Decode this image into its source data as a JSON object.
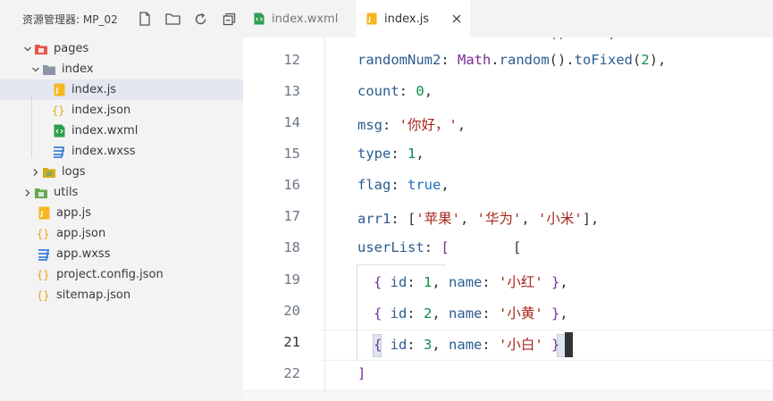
{
  "explorer": {
    "title": "资源管理器: MP_02",
    "actions": [
      "new-file-icon",
      "new-folder-icon",
      "refresh-icon",
      "collapse-all-icon"
    ],
    "tree": [
      {
        "label": "pages",
        "icon": "folder-pages-icon",
        "expanded": true
      },
      {
        "label": "index",
        "icon": "folder-icon",
        "expanded": true
      },
      {
        "label": "index.js",
        "icon": "js-file-icon",
        "selected": true
      },
      {
        "label": "index.json",
        "icon": "json-file-icon"
      },
      {
        "label": "index.wxml",
        "icon": "wxml-file-icon"
      },
      {
        "label": "index.wxss",
        "icon": "wxss-file-icon"
      },
      {
        "label": "logs",
        "icon": "folder-icon",
        "expanded": false
      },
      {
        "label": "utils",
        "icon": "folder-icon",
        "expanded": false
      },
      {
        "label": "app.js",
        "icon": "js-file-icon"
      },
      {
        "label": "app.json",
        "icon": "json-file-icon"
      },
      {
        "label": "app.wxss",
        "icon": "wxss-file-icon"
      },
      {
        "label": "project.config.json",
        "icon": "json-file-icon"
      },
      {
        "label": "sitemap.json",
        "icon": "json-file-icon"
      }
    ]
  },
  "tabs": [
    {
      "label": "index.wxml",
      "icon": "wxml-file-icon",
      "active": false
    },
    {
      "label": "index.js",
      "icon": "js-file-icon",
      "active": true,
      "close_icon": "close-icon"
    }
  ],
  "editor": {
    "lines": [
      {
        "number": "12",
        "text": "randomNum2: Math.random().toFixed(2),"
      },
      {
        "number": "13",
        "text": "count: 0,"
      },
      {
        "number": "14",
        "text": "msg: '你好，',"
      },
      {
        "number": "15",
        "text": "type: 1,"
      },
      {
        "number": "16",
        "text": "flag: true,"
      },
      {
        "number": "17",
        "text": "arr1: ['苹果', '华为', '小米'],"
      },
      {
        "number": "18",
        "text": "userList: ["
      },
      {
        "number": "19",
        "text": "{ id: 1, name: '小红' },"
      },
      {
        "number": "20",
        "text": "{ id: 2, name: '小黄' },"
      },
      {
        "number": "21",
        "text": "{ id: 3, name: '小白' }"
      },
      {
        "number": "22",
        "text": "]"
      }
    ],
    "stray_text": "["
  },
  "colors": {
    "key": "#2b5c8f",
    "punctuation": "#333333",
    "number": "#0a8f4a",
    "string": "#a6261c",
    "keyword": "#1f6fbf",
    "js_icon": "#f5b820",
    "json_icon": "#e8a317",
    "wxml_icon": "#2e9e4e",
    "wxss_icon": "#3c7fd8",
    "pages_folder_icon": "#e2574c",
    "utils_folder_icon": "#6aa84f",
    "logs_folder_icon": "#d5ac1a"
  }
}
